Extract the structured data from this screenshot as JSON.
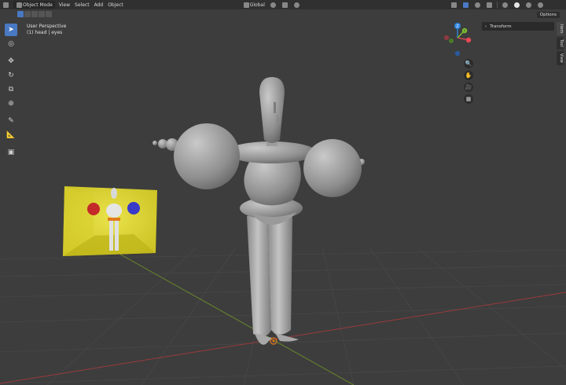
{
  "header": {
    "mode": "Object Mode",
    "menu": [
      "View",
      "Select",
      "Add",
      "Object"
    ],
    "orientation": "Global"
  },
  "options_label": "Options",
  "viewport": {
    "perspective": "User Perspective",
    "selection": "(1) head | eyes"
  },
  "gizmo": {
    "z": "Z",
    "y": "Y"
  },
  "panel": {
    "transform": "Transform"
  },
  "tabs": [
    "Item",
    "Tool",
    "View"
  ],
  "colors": {
    "accent": "#4a79c4",
    "axis_x": "#e84856",
    "axis_y": "#7fc232",
    "axis_z": "#2e86e0"
  }
}
